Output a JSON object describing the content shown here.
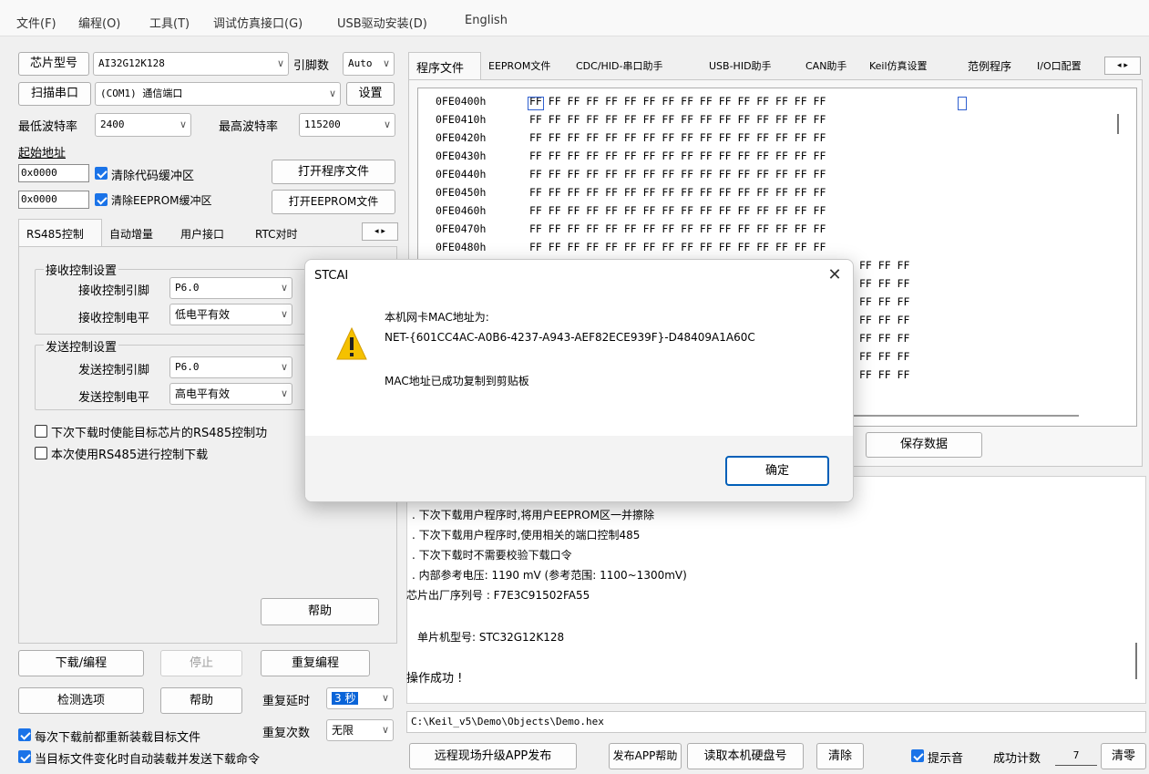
{
  "menu": [
    "文件(F)",
    "编程(O)",
    "工具(T)",
    "调试仿真接口(G)",
    "USB驱动安装(D)",
    "English"
  ],
  "left": {
    "chip_label": "芯片型号",
    "chip_value": "AI32G12K128",
    "pins_label": "引脚数",
    "pins_value": "Auto",
    "scan_label": "扫描串口",
    "port_value": "(COM1) 通信端口",
    "settings_label": "设置",
    "min_baud_label": "最低波特率",
    "min_baud_value": "2400",
    "max_baud_label": "最高波特率",
    "max_baud_value": "115200",
    "start_addr_label": "起始地址",
    "code_addr": "0x0000",
    "clear_code_label": "清除代码缓冲区",
    "open_program_label": "打开程序文件",
    "eeprom_addr": "0x0000",
    "clear_eeprom_label": "清除EEPROM缓冲区",
    "open_eeprom_label": "打开EEPROM文件",
    "tabs": [
      "RS485控制",
      "自动增量",
      "用户接口",
      "RTC对时"
    ],
    "recv_group": "接收控制设置",
    "recv_pin_label": "接收控制引脚",
    "recv_pin_value": "P6.0",
    "recv_level_label": "接收控制电平",
    "recv_level_value": "低电平有效",
    "send_group": "发送控制设置",
    "send_pin_label": "发送控制引脚",
    "send_pin_value": "P6.0",
    "send_level_label": "发送控制电平",
    "send_level_value": "高电平有效",
    "enable_rs485_label": "下次下载时使能目标芯片的RS485控制功",
    "use_rs485_label": "本次使用RS485进行控制下载",
    "help_label": "帮助",
    "download_label": "下载/编程",
    "stop_label": "停止",
    "repeat_label": "重复编程",
    "check_label": "检测选项",
    "help2_label": "帮助",
    "delay_label": "重复延时",
    "delay_value": "3 秒",
    "reload_label": "每次下载前都重新装载目标文件",
    "count_label": "重复次数",
    "count_value": "无限",
    "auto_label": "当目标文件变化时自动装载并发送下载命令"
  },
  "right": {
    "tabs": [
      "程序文件",
      "EEPROM文件",
      "CDC/HID-串口助手",
      "USB-HID助手",
      "CAN助手",
      "Keil仿真设置",
      "范例程序",
      "I/O口配置"
    ],
    "hex_rows": [
      {
        "addr": "0FE0400h",
        "data": "FF FF FF FF FF FF FF FF FF FF FF FF FF FF FF FF"
      },
      {
        "addr": "0FE0410h",
        "data": "FF FF FF FF FF FF FF FF FF FF FF FF FF FF FF FF"
      },
      {
        "addr": "0FE0420h",
        "data": "FF FF FF FF FF FF FF FF FF FF FF FF FF FF FF FF"
      },
      {
        "addr": "0FE0430h",
        "data": "FF FF FF FF FF FF FF FF FF FF FF FF FF FF FF FF"
      },
      {
        "addr": "0FE0440h",
        "data": "FF FF FF FF FF FF FF FF FF FF FF FF FF FF FF FF"
      },
      {
        "addr": "0FE0450h",
        "data": "FF FF FF FF FF FF FF FF FF FF FF FF FF FF FF FF"
      },
      {
        "addr": "0FE0460h",
        "data": "FF FF FF FF FF FF FF FF FF FF FF FF FF FF FF FF"
      },
      {
        "addr": "0FE0470h",
        "data": "FF FF FF FF FF FF FF FF FF FF FF FF FF FF FF FF"
      },
      {
        "addr": "0FE0480h",
        "data": "FF FF FF FF FF FF FF FF FF FF FF FF FF FF FF FF"
      }
    ],
    "hidden_rows_tail": "FF FF FF",
    "save_data_label": "保存数据",
    "log": [
      ". 下次下载用户程序时,将用户EEPROM区一并擦除",
      ". 下次下载用户程序时,使用相关的端口控制485",
      ". 下次下载时不需要校验下载口令",
      ". 内部参考电压: 1190 mV (参考范围: 1100~1300mV)",
      "芯片出厂序列号 : F7E3C91502FA55",
      "单片机型号: STC32G12K128",
      "操作成功 !"
    ],
    "file_path": "C:\\Keil_v5\\Demo\\Objects\\Demo.hex",
    "remote_label": "远程现场升级APP发布",
    "publish_help_label": "发布APP帮助",
    "read_disk_label": "读取本机硬盘号",
    "clear_label": "清除",
    "sound_label": "提示音",
    "success_label": "成功计数",
    "success_value": "7",
    "reset_label": "清零"
  },
  "dialog": {
    "title": "STCAI",
    "line1": "本机网卡MAC地址为:",
    "line2": "NET-{601CC4AC-A0B6-4237-A943-AEF82ECE939F}-D48409A1A60C",
    "line3": "MAC地址已成功复制到剪贴板",
    "ok_label": "确定"
  }
}
